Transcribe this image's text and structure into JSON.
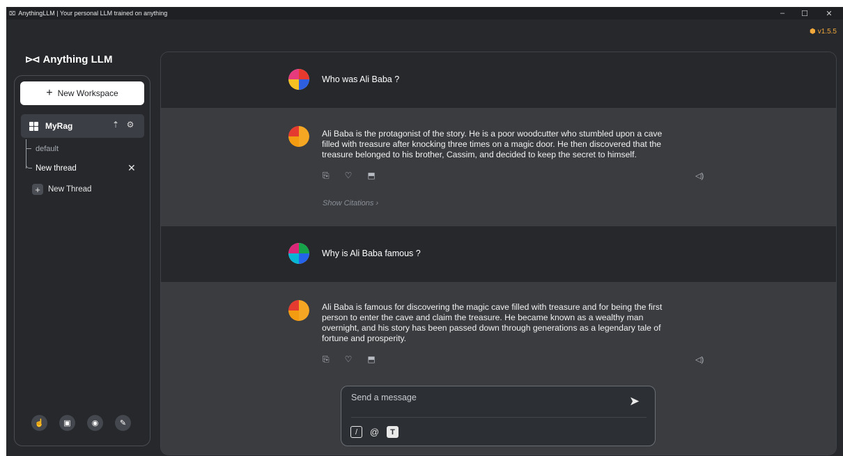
{
  "window": {
    "icon": "anythingllm-logo-icon",
    "title": "AnythingLLM | Your personal LLM trained on anything",
    "controls": {
      "minimize": "–",
      "maximize": "☐",
      "close": "✕"
    }
  },
  "version": {
    "label": "v1.5.5",
    "color": "#f3a83b"
  },
  "brand": {
    "name": "Anything LLM",
    "logo": "⌧"
  },
  "sidebar": {
    "new_workspace_label": "New Workspace",
    "workspace": {
      "name": "MyRag",
      "icons": [
        "upload-icon",
        "settings-gear-icon"
      ]
    },
    "threads": [
      {
        "label": "default",
        "active": false
      },
      {
        "label": "New thread",
        "active": true
      }
    ],
    "new_thread_label": "New Thread",
    "footer_icons": [
      "community-hub-icon",
      "docs-book-icon",
      "discord-icon",
      "admin-wrench-icon"
    ]
  },
  "chat": {
    "messages": [
      {
        "role": "user",
        "text": "Who was Ali Baba ?"
      },
      {
        "role": "assistant",
        "lines": [
          "Ali Baba is the protagonist of the story. He is a poor woodcutter who stumbled upon a cave",
          "filled with treasure after knocking three times on a magic door. He then discovered that the",
          "treasure belonged to his brother, Cassim, and decided to keep the secret to himself."
        ],
        "citations_label": "Show Citations"
      },
      {
        "role": "user",
        "text": "Why is Ali Baba famous ?"
      },
      {
        "role": "assistant",
        "lines": [
          "Ali Baba is famous for discovering the magic cave filled with treasure and for being the first",
          "person to enter the cave and claim the treasure. He became known as a wealthy man",
          "overnight, and his story has been passed down through generations as a legendary tale of",
          "fortune and prosperity."
        ]
      }
    ]
  },
  "composer": {
    "placeholder": "Send a message",
    "tools": [
      "slash-command-icon",
      "at-mention-icon",
      "text-size-icon"
    ]
  },
  "colors": {
    "background": "#26282c",
    "assistant_band": "#3a3c40",
    "accent": "#f3a83b"
  }
}
